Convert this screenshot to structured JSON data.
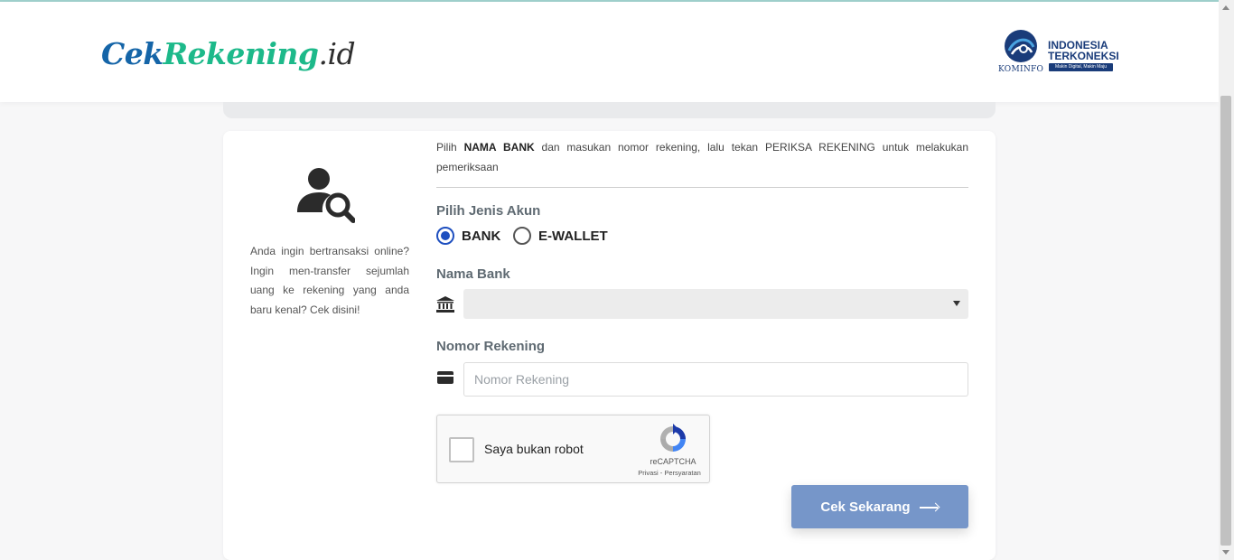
{
  "header": {
    "logo": {
      "part1": "Cek",
      "part2": "Rekening",
      "part3": ".id"
    },
    "kominfo": {
      "label": "KOMINFO",
      "line1": "INDONESIA",
      "line2": "TERKONEKSI",
      "tagline": "Makin Digital, Makin Maju"
    }
  },
  "intro": {
    "text": "Anda ingin bertransaksi online? Ingin men-transfer sejumlah uang ke rekening yang anda baru kenal? Cek disini!"
  },
  "form": {
    "instruction": {
      "pre": "Pilih ",
      "bold": "NAMA BANK",
      "post": " dan masukan nomor rekening, lalu tekan PERIKSA REKENING untuk melakukan pemeriksaan"
    },
    "jenis_label": "Pilih Jenis Akun",
    "options": [
      {
        "label": "BANK",
        "selected": true
      },
      {
        "label": "E-WALLET",
        "selected": false
      }
    ],
    "bank_label": "Nama Bank",
    "bank_value": "",
    "rekening_label": "Nomor Rekening",
    "rekening_placeholder": "Nomor Rekening",
    "rekening_value": "",
    "submit_label": "Cek Sekarang"
  },
  "captcha": {
    "label": "Saya bukan robot",
    "brand": "reCAPTCHA",
    "links": "Privasi - Persyaratan",
    "checked": false
  },
  "colors": {
    "logo_blue": "#1565a8",
    "logo_green": "#1db98a",
    "radio_accent": "#1e4fbf",
    "button_bg": "#7696c9",
    "label_grey": "#5f6a72"
  },
  "icons": [
    "user-search-icon",
    "bank-building-icon",
    "credit-card-icon",
    "recaptcha-logo-icon",
    "arrow-right-icon",
    "kominfo-emblem-icon",
    "dropdown-caret-icon"
  ]
}
